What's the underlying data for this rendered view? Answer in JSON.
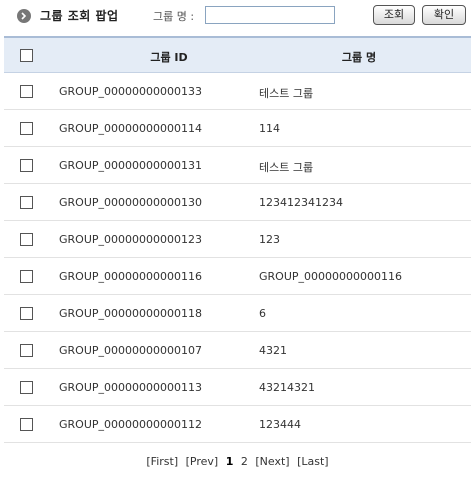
{
  "header": {
    "title": "그룹 조회 팝업",
    "search_label": "그룹 명 :",
    "search_value": "",
    "search_button": "조회",
    "confirm_button": "확인"
  },
  "table": {
    "columns": [
      "그룹 ID",
      "그룹 명"
    ],
    "rows": [
      {
        "id": "GROUP_00000000000133",
        "name": "테스트 그룹"
      },
      {
        "id": "GROUP_00000000000114",
        "name": "114"
      },
      {
        "id": "GROUP_00000000000131",
        "name": "테스트 그룹"
      },
      {
        "id": "GROUP_00000000000130",
        "name": "123412341234"
      },
      {
        "id": "GROUP_00000000000123",
        "name": "123"
      },
      {
        "id": "GROUP_00000000000116",
        "name": "GROUP_00000000000116"
      },
      {
        "id": "GROUP_00000000000118",
        "name": "6"
      },
      {
        "id": "GROUP_00000000000107",
        "name": "4321"
      },
      {
        "id": "GROUP_00000000000113",
        "name": "43214321"
      },
      {
        "id": "GROUP_00000000000112",
        "name": "123444"
      }
    ]
  },
  "pagination": {
    "first": "[First]",
    "prev": "[Prev]",
    "pages": [
      "1",
      "2"
    ],
    "current": "1",
    "next": "[Next]",
    "last": "[Last]"
  },
  "icons": {
    "title": "circle-chevron-right-icon"
  },
  "colors": {
    "header_bg": "#e4ecf6",
    "header_border": "#a9bcd6",
    "row_border": "#e2e2e2"
  }
}
